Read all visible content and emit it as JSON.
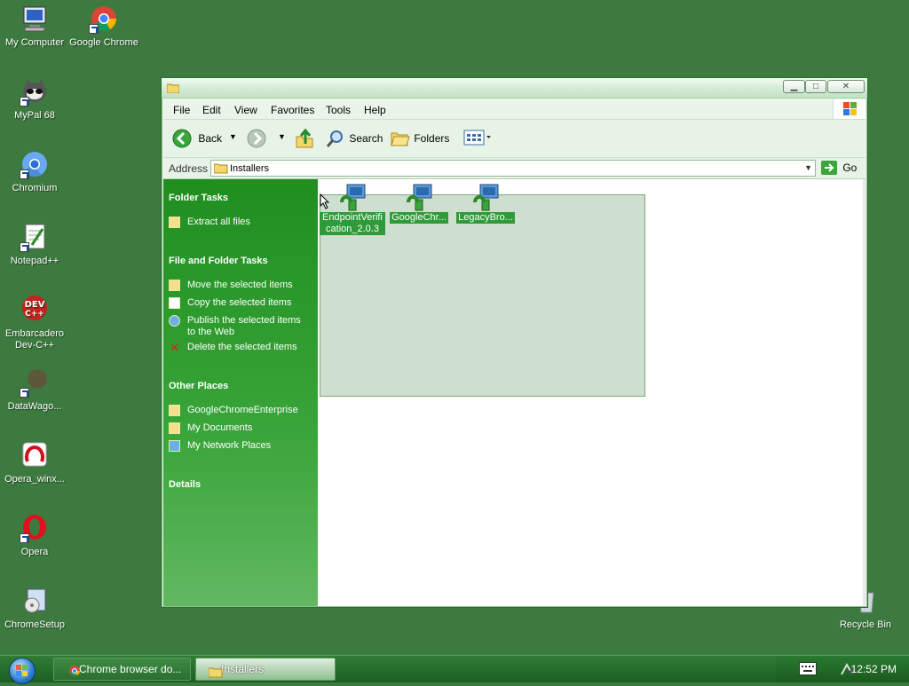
{
  "desktop": {
    "icons": [
      {
        "label": "My Computer",
        "icon": "computer-icon"
      },
      {
        "label": "Google Chrome",
        "icon": "chrome-icon"
      },
      {
        "label": "MyPal 68",
        "icon": "mypal-icon"
      },
      {
        "label": "Chromium",
        "icon": "chromium-icon"
      },
      {
        "label": "Notepad++",
        "icon": "notepad-plus-plus-icon"
      },
      {
        "label": "Embarcadero Dev-C++",
        "icon": "devcpp-icon"
      },
      {
        "label": "DataWago...",
        "icon": "datawagon-icon"
      },
      {
        "label": "Opera_winx...",
        "icon": "opera-installer-icon"
      },
      {
        "label": "Opera",
        "icon": "opera-icon"
      },
      {
        "label": "ChromeSetup",
        "icon": "setup-icon"
      },
      {
        "label": "Recycle Bin",
        "icon": "recycle-bin-icon"
      }
    ]
  },
  "window": {
    "menu": [
      "File",
      "Edit",
      "View",
      "Favorites",
      "Tools",
      "Help"
    ],
    "toolbar": {
      "back": "Back",
      "search": "Search",
      "folders": "Folders"
    },
    "address": {
      "label": "Address",
      "value": "Installers",
      "go": "Go"
    },
    "taskpane": {
      "folder_tasks": {
        "title": "Folder Tasks",
        "items": [
          "Extract all files"
        ]
      },
      "file_tasks": {
        "title": "File and Folder Tasks",
        "items": [
          "Move the selected items",
          "Copy the selected items",
          "Publish the selected items to the Web",
          "Delete the selected items"
        ]
      },
      "other_places": {
        "title": "Other Places",
        "items": [
          "GoogleChromeEnterprise",
          "My Documents",
          "My Network Places"
        ]
      },
      "details": {
        "title": "Details"
      }
    },
    "files": [
      {
        "name": "EndpointVerification_2.0.3",
        "display": "EndpointVerification_2.0.3"
      },
      {
        "name": "GoogleChr...",
        "display": "GoogleChr..."
      },
      {
        "name": "LegacyBro...",
        "display": "LegacyBro..."
      }
    ]
  },
  "taskbar": {
    "buttons": [
      {
        "label": "Chrome browser do...",
        "icon": "chrome-icon"
      },
      {
        "label": "Installers",
        "icon": "folder-icon"
      }
    ],
    "clock": "12:52 PM"
  },
  "colors": {
    "desktop_bg": "#3d7a3f",
    "taskpane_green": "#1f8e1f",
    "selection_label": "#2f9a3a"
  }
}
